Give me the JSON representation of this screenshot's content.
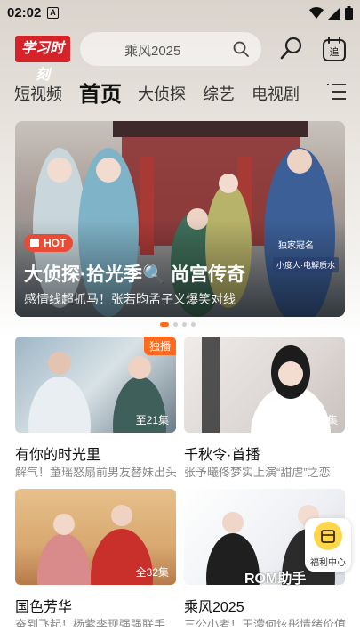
{
  "status_bar": {
    "time": "02:02",
    "notif_letter": "A"
  },
  "header": {
    "logo_text": "学习时刻",
    "search": {
      "text": "乘风2025"
    }
  },
  "tabs": [
    {
      "label": "短视频",
      "active": false
    },
    {
      "label": "首页",
      "active": true
    },
    {
      "label": "大侦探",
      "active": false
    },
    {
      "label": "综艺",
      "active": false
    },
    {
      "label": "电视剧",
      "active": false
    }
  ],
  "banner": {
    "badge": "HOT",
    "title": "大侦探·拾光季🔍 尚宫传奇",
    "subtitle": "感情线超抓马！张若昀孟子义爆笑对线",
    "tag1": "独家冠名",
    "tag2": "小度人·电解质水",
    "dots_count": 4,
    "active_dot": 0
  },
  "cards": [
    {
      "title": "有你的时光里",
      "subtitle": "解气！童瑶怒扇前男友替妹出头",
      "episodes": "至21集",
      "exclusive": "独播"
    },
    {
      "title": "千秋令·首播",
      "subtitle": "张予曦佟梦实上演“甜虐”之恋",
      "episodes": "至4集",
      "exclusive": ""
    },
    {
      "title": "国色芳华",
      "subtitle": "奋到飞起！杨紫李现强强联手",
      "episodes": "全32集",
      "exclusive": ""
    },
    {
      "title": "乘风2025",
      "subtitle": "三公小考！王濛何炫彤情绪价值",
      "episodes": "",
      "exclusive": ""
    }
  ],
  "float_widget": {
    "label": "福利中心"
  },
  "watermark": "ROM助手",
  "colors": {
    "accent": "#ff6a1f",
    "logo_red": "#d6232a",
    "hot_red": "#e84b36"
  }
}
